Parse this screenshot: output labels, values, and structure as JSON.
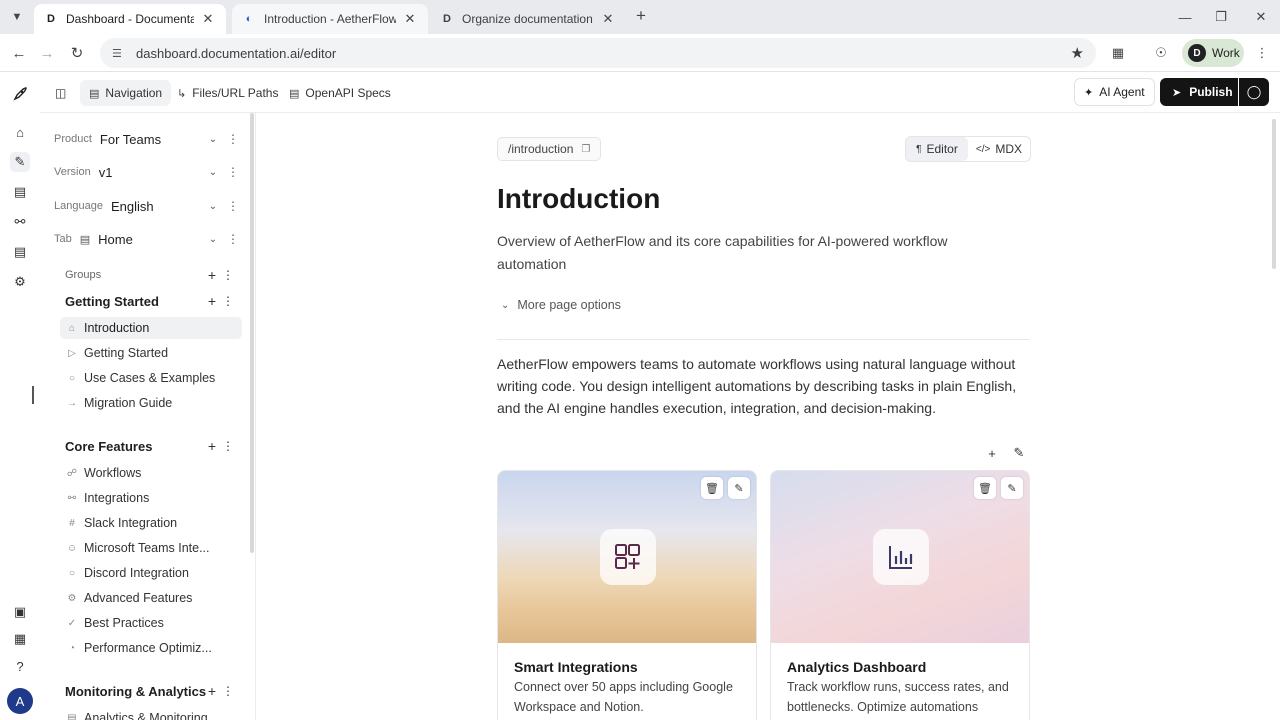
{
  "browser": {
    "tabs": [
      {
        "title": "Dashboard - Documentation.AI",
        "favicon": "D"
      },
      {
        "title": "Introduction - AetherFlow Docu",
        "favicon": "◐"
      },
      {
        "title": "Organize documentation structu",
        "favicon": "D"
      }
    ],
    "url": "dashboard.documentation.ai/editor",
    "profile_initial": "D",
    "profile_label": "Work"
  },
  "toolbar": {
    "navigation": "Navigation",
    "files": "Files/URL Paths",
    "openapi": "OpenAPI Specs",
    "ai_agent": "AI Agent",
    "publish": "Publish"
  },
  "sidebar": {
    "product": {
      "label": "Product",
      "value": "For Teams"
    },
    "version": {
      "label": "Version",
      "value": "v1"
    },
    "language": {
      "label": "Language",
      "value": "English"
    },
    "tab": {
      "label": "Tab",
      "value": "Home"
    },
    "groups_label": "Groups",
    "groups": [
      {
        "title": "Getting Started",
        "items": [
          {
            "label": "Introduction",
            "icon": "home-icon"
          },
          {
            "label": "Getting Started",
            "icon": "play-icon"
          },
          {
            "label": "Use Cases & Examples",
            "icon": "bulb-icon"
          },
          {
            "label": "Migration Guide",
            "icon": "arrow-icon"
          }
        ]
      },
      {
        "title": "Core Features",
        "items": [
          {
            "label": "Workflows",
            "icon": "workflow-icon"
          },
          {
            "label": "Integrations",
            "icon": "plug-icon"
          },
          {
            "label": "Slack Integration",
            "icon": "slack-icon"
          },
          {
            "label": "Microsoft Teams Inte...",
            "icon": "users-icon"
          },
          {
            "label": "Discord Integration",
            "icon": "chat-icon"
          },
          {
            "label": "Advanced Features",
            "icon": "gear-icon"
          },
          {
            "label": "Best Practices",
            "icon": "check-icon"
          },
          {
            "label": "Performance Optimiz...",
            "icon": "gauge-icon"
          }
        ]
      },
      {
        "title": "Monitoring & Analytics",
        "items": [
          {
            "label": "Analytics & Monitoring",
            "icon": "chart-icon"
          }
        ]
      }
    ]
  },
  "editor": {
    "path": "/introduction",
    "mode_editor": "Editor",
    "mode_mdx": "MDX",
    "title": "Introduction",
    "description": "Overview of AetherFlow and its core capabilities for AI-powered workflow automation",
    "more_options": "More page options",
    "body": "AetherFlow empowers teams to automate workflows using natural language without writing code. You design intelligent automations by describing tasks in plain English, and the AI engine handles execution, integration, and decision-making.",
    "cards": [
      {
        "title": "Smart Integrations",
        "text": "Connect over 50 apps including Google Workspace and Notion.",
        "icon": "grid-plus-icon"
      },
      {
        "title": "Analytics Dashboard",
        "text": "Track workflow runs, success rates, and bottlenecks. Optimize automations",
        "icon": "bar-chart-icon"
      }
    ]
  }
}
